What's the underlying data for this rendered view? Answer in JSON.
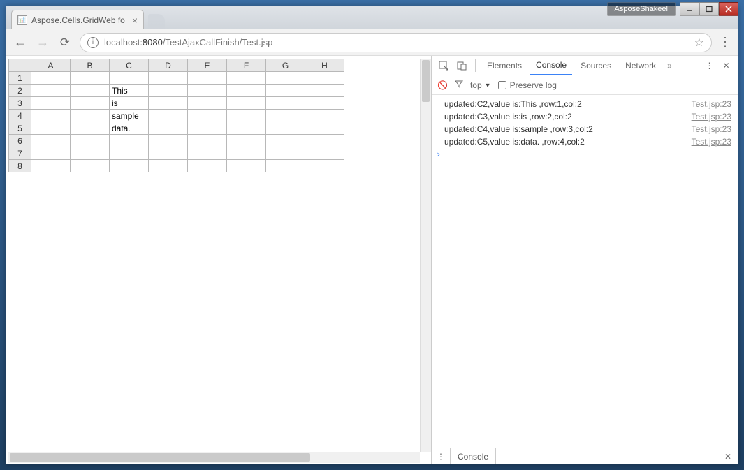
{
  "window": {
    "user_label": "AsposeShakeel"
  },
  "browser": {
    "tab_title": "Aspose.Cells.GridWeb fo",
    "url_host": "localhost",
    "url_port": ":8080",
    "url_path": "/TestAjaxCallFinish/Test.jsp"
  },
  "sheet": {
    "cols": [
      "A",
      "B",
      "C",
      "D",
      "E",
      "F",
      "G",
      "H"
    ],
    "rows": [
      "1",
      "2",
      "3",
      "4",
      "5",
      "6",
      "7",
      "8"
    ],
    "cells": {
      "C2": "This",
      "C3": "is",
      "C4": "sample",
      "C5": "data."
    }
  },
  "devtools": {
    "tabs": {
      "elements": "Elements",
      "console": "Console",
      "sources": "Sources",
      "network": "Network"
    },
    "toolbar": {
      "context": "top",
      "preserve": "Preserve log"
    },
    "logs": [
      {
        "msg": "updated:C2,value is:This ,row:1,col:2",
        "src": "Test.jsp:23"
      },
      {
        "msg": "updated:C3,value is:is ,row:2,col:2",
        "src": "Test.jsp:23"
      },
      {
        "msg": "updated:C4,value is:sample ,row:3,col:2",
        "src": "Test.jsp:23"
      },
      {
        "msg": "updated:C5,value is:data. ,row:4,col:2",
        "src": "Test.jsp:23"
      }
    ],
    "drawer": {
      "label": "Console"
    }
  }
}
